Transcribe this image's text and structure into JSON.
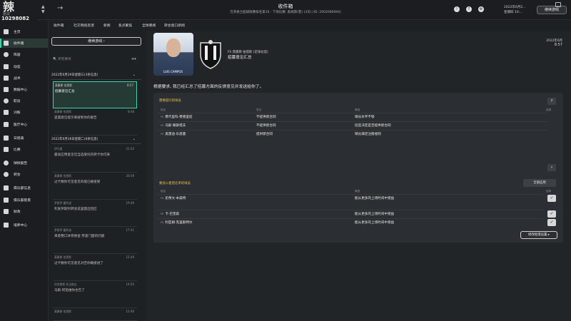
{
  "app": {
    "logo_text": "辣",
    "logo_sub": "图说",
    "club_id": "10298082"
  },
  "header": {
    "title": "收件箱",
    "subtitle": "在英格兰超级联赛排名第16 · 下场比赛: 奥胡斯(客) (3天) (ID: 2002066094)",
    "date_line1": "2022年6月2...",
    "date_line2": "星期四 10:...",
    "continue_label": "继续游戏",
    "icons": [
      "lightbulb-icon",
      "help-icon",
      "settings-icon"
    ]
  },
  "sidebar": {
    "items": [
      {
        "label": "主页",
        "icon": "home-icon"
      },
      {
        "label": "收件箱",
        "icon": "inbox-icon",
        "active": true
      },
      {
        "label": "阵容",
        "icon": "squad-icon"
      },
      {
        "label": "动态",
        "icon": "dynamics-icon"
      },
      {
        "label": "战术",
        "icon": "tactics-icon"
      },
      {
        "label": "数据中心",
        "icon": "data-hub-icon"
      },
      {
        "label": "职员",
        "icon": "staff-icon"
      },
      {
        "label": "训练",
        "icon": "training-icon"
      },
      {
        "label": "医疗中心",
        "icon": "medical-icon"
      },
      {
        "label": "日程表",
        "icon": "calendar-icon"
      },
      {
        "label": "比赛",
        "icon": "competitions-icon"
      },
      {
        "label": "球探报告",
        "icon": "scouting-icon"
      },
      {
        "label": "转会",
        "icon": "transfers-icon"
      },
      {
        "label": "俱乐部信息",
        "icon": "club-info-icon"
      },
      {
        "label": "俱乐部愿景",
        "icon": "club-vision-icon"
      },
      {
        "label": "财政",
        "icon": "finances-icon"
      },
      {
        "label": "培养中心",
        "icon": "development-icon"
      }
    ]
  },
  "subnav": {
    "items": [
      "收件箱",
      "社交网络反馈",
      "新闻",
      "焦点聚焦",
      "全球要闻",
      "转会窗口新闻"
    ]
  },
  "inbox": {
    "continue_label": "继续游戏",
    "search_placeholder": "所有事项",
    "groups": [
      {
        "header": "2022年6月29日星期三(3条信息)",
        "messages": [
          {
            "from": "莫康斯·伯恩斯",
            "time": "8:57",
            "subject": "招募意见汇总",
            "selected": true
          },
          {
            "from": "莫康斯·伯恩斯",
            "time": "8:48",
            "subject": "遗漏意见提示来搜到你的报告",
            "selected": false
          }
        ]
      },
      {
        "header": "2022年6月28日星期二(6条信息)",
        "messages": [
          {
            "from": "伊凡星",
            "time": "21:02",
            "subject": "最高应用意见见当选受托的转卡你可来",
            "selected": false
          },
          {
            "from": "莫康斯·伯恩斯",
            "time": "20:59",
            "subject": "过卡数你可见意见的能已被接受",
            "selected": false
          },
          {
            "from": "罗斯罗·霍利迪",
            "time": "19:49",
            "subject": "利发罗斯利转会说里面出回应",
            "selected": false
          },
          {
            "from": "罗斯罗·霍利迪",
            "time": "17:41",
            "subject": "来意整口体育换查·劳逢门面的问题",
            "selected": false
          },
          {
            "from": "莫康斯·伯恩斯",
            "time": "15:49",
            "subject": "过卡数你可见意见对否你确接进了",
            "selected": false
          },
          {
            "from": "伯克斯斯·托达维吉",
            "time": "14:50",
            "subject": "马斯·阿茄维你也告了",
            "selected": false
          },
          {
            "from": "莫康斯·伯恩斯",
            "time": "12:46",
            "subject": "",
            "selected": false
          }
        ]
      }
    ]
  },
  "message": {
    "sender_line": "莫康斯·伯恩斯 (足球总监)",
    "title": "招募意见汇总",
    "date": "2022年6月",
    "time": "8:57",
    "photo_label": "LUIS CAMPOS",
    "body": "根据要求, 我已经汇总了招募方面的反馈意见并发送给你了。"
  },
  "feedback": {
    "section1_title": "需要提问的球员",
    "columns": [
      "姓名",
      "意见",
      "原因",
      "选择"
    ],
    "rows": [
      {
        "tag": "FS",
        "name": "费代里科·费德里延",
        "opinion": "不提供新合同",
        "reason": "球员水平不够"
      },
      {
        "tag": "FS",
        "name": "马斯·赖斯塔夫",
        "opinion": "不提供新合同",
        "reason": "延后决定是否提供新合同"
      },
      {
        "tag": "FS",
        "name": "奥雷迪·乐恩曼",
        "opinion": "提供新合同",
        "reason": "球员满足注册规则"
      }
    ],
    "section2_title": "要加入租借名单的球员",
    "apply_all_label": "全部应用",
    "columns2": [
      "姓名",
      "原因",
      "选择"
    ],
    "rows2": [
      {
        "tag": "FS",
        "name": "史蒂文·本森特",
        "reason": "能从更多的上场时间中受益"
      },
      {
        "tag": "FS",
        "name": "卡·巴奎森",
        "reason": "能从更多的上场时间中受益"
      },
      {
        "tag": "FS",
        "name": "利亚姆·克里斯特尔",
        "reason": "能从更多的上场时间中受益"
      }
    ],
    "edit_label": "修改租借设置 ▸"
  }
}
